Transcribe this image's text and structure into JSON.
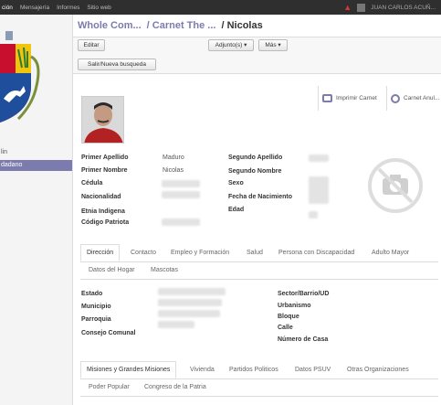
{
  "topbar": {
    "menu": [
      "ción",
      "Mensajería",
      "Informes",
      "Sitio web"
    ],
    "user": "JUAN CARLOS ACUÑ..."
  },
  "sidebar": {
    "items": [
      {
        "label": "lin"
      },
      {
        "label": "dadano"
      }
    ]
  },
  "breadcrumb": [
    "Whole Com...",
    "/ Carnet The ...",
    "/ Nicolas"
  ],
  "toolbar": {
    "edit": "Editar",
    "attach": "Adjunto(s) ▾",
    "more": "Más ▾",
    "exit": "Salir/Nueva busqueda"
  },
  "stat_buttons": {
    "print": "Imprimir Carnet",
    "cancel": "Carnet Anul..."
  },
  "fields": {
    "primer_apellido": {
      "label": "Primer Apellido",
      "value": "Maduro"
    },
    "primer_nombre": {
      "label": "Primer Nombre",
      "value": "Nicolas"
    },
    "cedula": {
      "label": "Cédula"
    },
    "nacionalidad": {
      "label": "Nacionalidad"
    },
    "etnia": {
      "label": "Etnia Indigena"
    },
    "codigo": {
      "label": "Código Patriota"
    },
    "segundo_apellido": {
      "label": "Segundo Apellido"
    },
    "segundo_nombre": {
      "label": "Segundo Nombre"
    },
    "sexo": {
      "label": "Sexo"
    },
    "fecha": {
      "label": "Fecha de Nacimiento"
    },
    "edad": {
      "label": "Edad"
    }
  },
  "tabs1": [
    "Dirección",
    "Contacto",
    "Empleo y Formación",
    "Salud",
    "Persona con Discapacidad",
    "Adulto Mayor",
    "Datos del Hogar",
    "Mascotas"
  ],
  "address": {
    "estado": "Estado",
    "municipio": "Municipio",
    "parroquia": "Parroquia",
    "consejo": "Consejo Comunal",
    "sector": "Sector/Barrio/UD",
    "urbanismo": "Urbanismo",
    "bloque": "Bloque",
    "calle": "Calle",
    "casa": "Número de Casa"
  },
  "tabs2": [
    "Misiones y Grandes Misiones",
    "Vivienda",
    "Partidos Politicos",
    "Datos PSUV",
    "Otras Organizaciones",
    "Poder Popular",
    "Congreso de la Patria"
  ]
}
